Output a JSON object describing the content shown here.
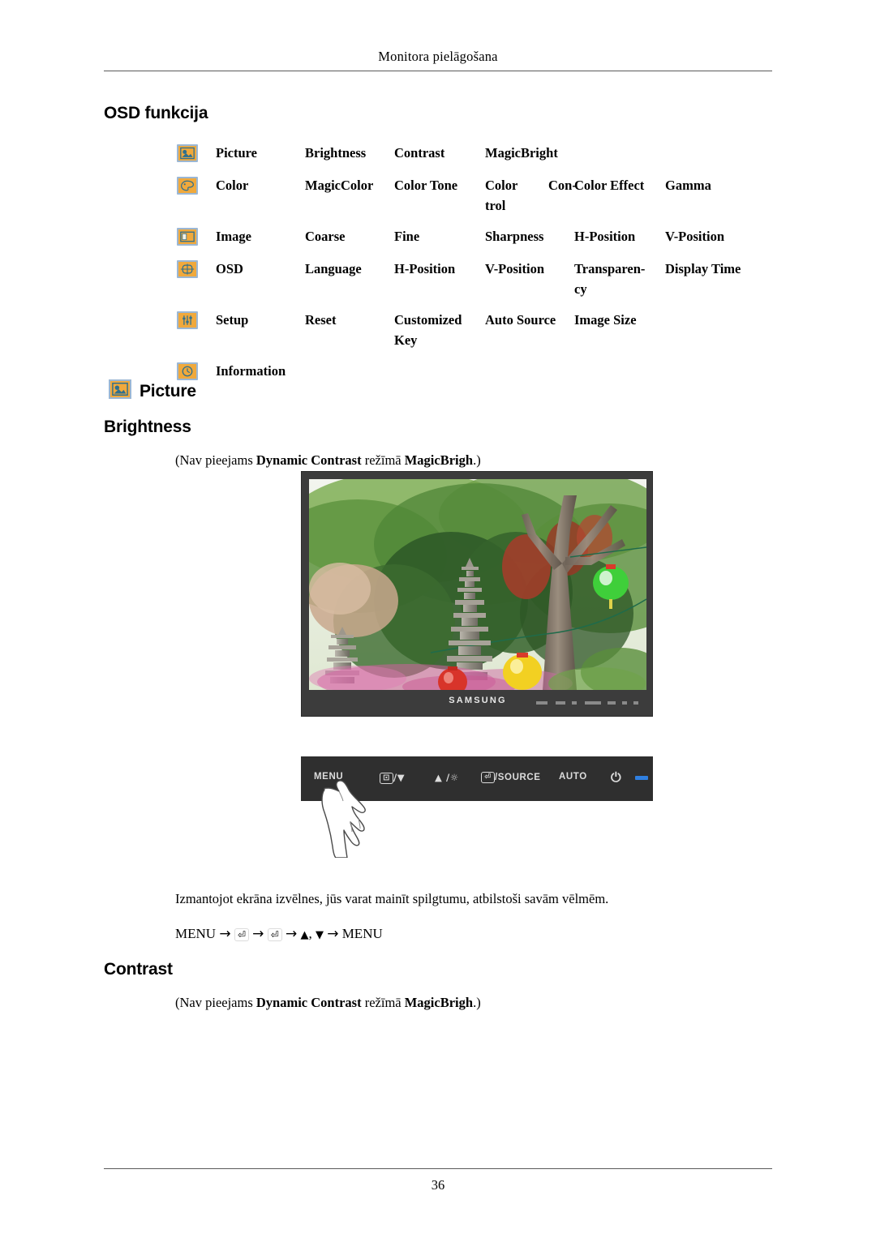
{
  "header": {
    "running_head": "Monitora pielāgošana"
  },
  "headings": {
    "osd_function": "OSD funkcija",
    "picture": "Picture",
    "brightness": "Brightness",
    "contrast": "Contrast"
  },
  "osd_table": {
    "rows": [
      {
        "icon": "picture-icon",
        "label": "Picture",
        "items": [
          "Brightness",
          "Contrast",
          "MagicBright"
        ]
      },
      {
        "icon": "color-icon",
        "label": "Color",
        "items": [
          "MagicColor",
          "Color Tone",
          "Color",
          "Con-",
          "trol",
          "Color Effect",
          "Gamma"
        ]
      },
      {
        "icon": "image-icon",
        "label": "Image",
        "items": [
          "Coarse",
          "Fine",
          "Sharpness",
          "H-Position",
          "V-Position"
        ]
      },
      {
        "icon": "osd-icon",
        "label": "OSD",
        "items": [
          "Language",
          "H-Position",
          "V-Position",
          "Transparen-",
          "cy",
          "Display Time"
        ]
      },
      {
        "icon": "setup-icon",
        "label": "Setup",
        "items": [
          "Reset",
          "Customized",
          "Key",
          "Auto Source",
          "Image Size"
        ]
      },
      {
        "icon": "information-icon",
        "label": "Information",
        "items": []
      }
    ]
  },
  "notes": {
    "brightness_note_1": "(Nav pieejams ",
    "brightness_note_bold_1": "Dynamic Contrast",
    "brightness_note_2": " režīmā ",
    "brightness_note_bold_2": "MagicBrigh",
    "brightness_note_3": ".)",
    "contrast_note_1": "(Nav pieejams ",
    "contrast_note_bold_1": "Dynamic Contrast",
    "contrast_note_2": " režīmā ",
    "contrast_note_bold_2": "MagicBrigh",
    "contrast_note_3": ".)"
  },
  "instructions": {
    "brightness_text": "Izmantojot ekrāna izvēlnes, jūs varat mainīt spilgtumu, atbilstoši savām vēlmēm.",
    "sequence": {
      "menu_start": "MENU",
      "arrow": "→",
      "enter_key": "⏎",
      "up": "▲",
      "comma": ",",
      "down": "▼",
      "menu_end": "MENU"
    }
  },
  "monitor": {
    "brand": "SAMSUNG",
    "screen_alt": "Garden scene with stone pagodas, trees and paper lanterns"
  },
  "control_panel": {
    "buttons": [
      {
        "name": "menu-button",
        "label": "MENU"
      },
      {
        "name": "down-button",
        "label": "/▼",
        "key": "⊡"
      },
      {
        "name": "up-button",
        "label": "▲ /",
        "key": "☼"
      },
      {
        "name": "source-button",
        "label": "/SOURCE",
        "key": "⏎"
      },
      {
        "name": "auto-button",
        "label": "AUTO"
      },
      {
        "name": "power-button",
        "label": "⏻"
      }
    ],
    "led_color": "#2f7fe0"
  },
  "footer": {
    "page_number": "36"
  },
  "colors": {
    "icon_fill": "#f0a93c",
    "icon_border": "#9bb7d4",
    "bezel": "#3c3c3c",
    "panel": "#2f2f2f",
    "rule": "#5a5a5a"
  }
}
